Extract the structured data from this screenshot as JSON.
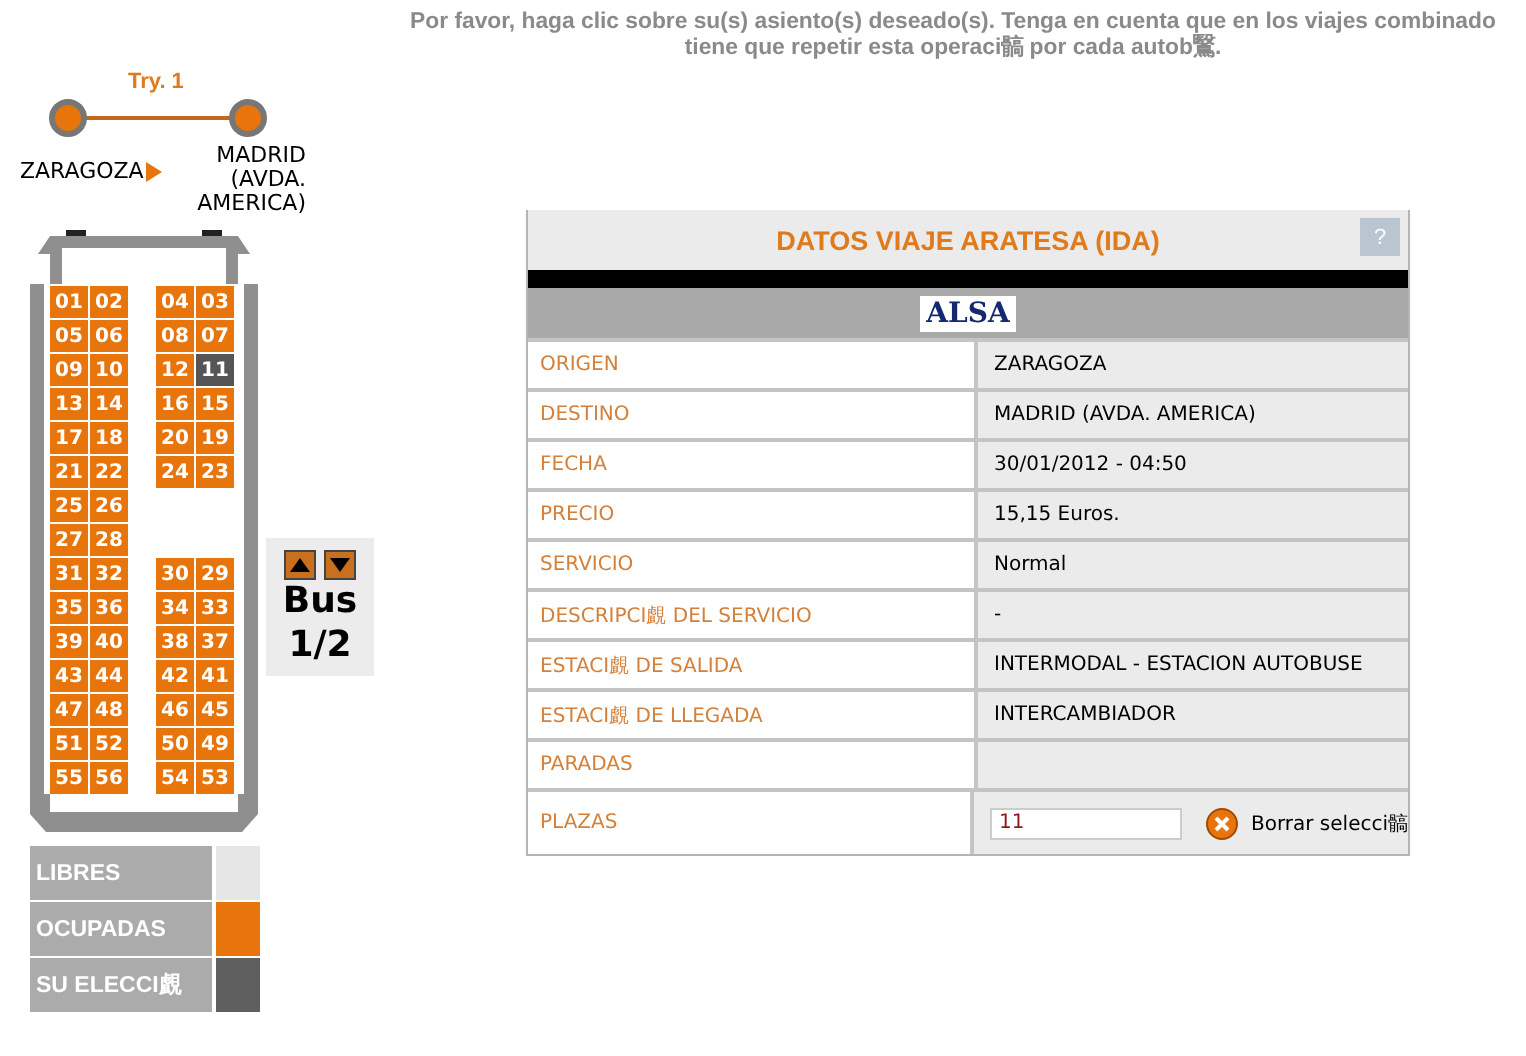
{
  "instructions": [
    "Por favor, haga clic sobre su(s) asiento(s) deseado(s). Tenga en cuenta que en los viajes combinado",
    "tiene que repetir esta operaci髇  por cada autob鷖."
  ],
  "route": {
    "leg": "Try. 1",
    "origin": "ZARAGOZA",
    "destination": "MADRID (AVDA. AMERICA)"
  },
  "seat_rows": [
    {
      "left": [
        {
          "number": "01",
          "selected": false
        },
        {
          "number": "02",
          "selected": false
        }
      ],
      "right": [
        {
          "number": "04",
          "selected": false
        },
        {
          "number": "03",
          "selected": false
        }
      ]
    },
    {
      "left": [
        {
          "number": "05",
          "selected": false
        },
        {
          "number": "06",
          "selected": false
        }
      ],
      "right": [
        {
          "number": "08",
          "selected": false
        },
        {
          "number": "07",
          "selected": false
        }
      ]
    },
    {
      "left": [
        {
          "number": "09",
          "selected": false
        },
        {
          "number": "10",
          "selected": false
        }
      ],
      "right": [
        {
          "number": "12",
          "selected": false
        },
        {
          "number": "11",
          "selected": true
        }
      ]
    },
    {
      "left": [
        {
          "number": "13",
          "selected": false
        },
        {
          "number": "14",
          "selected": false
        }
      ],
      "right": [
        {
          "number": "16",
          "selected": false
        },
        {
          "number": "15",
          "selected": false
        }
      ]
    },
    {
      "left": [
        {
          "number": "17",
          "selected": false
        },
        {
          "number": "18",
          "selected": false
        }
      ],
      "right": [
        {
          "number": "20",
          "selected": false
        },
        {
          "number": "19",
          "selected": false
        }
      ]
    },
    {
      "left": [
        {
          "number": "21",
          "selected": false
        },
        {
          "number": "22",
          "selected": false
        }
      ],
      "right": [
        {
          "number": "24",
          "selected": false
        },
        {
          "number": "23",
          "selected": false
        }
      ]
    },
    {
      "left": [
        {
          "number": "25",
          "selected": false
        },
        {
          "number": "26",
          "selected": false
        }
      ],
      "right": []
    },
    {
      "left": [
        {
          "number": "27",
          "selected": false
        },
        {
          "number": "28",
          "selected": false
        }
      ],
      "right": []
    },
    {
      "left": [
        {
          "number": "31",
          "selected": false
        },
        {
          "number": "32",
          "selected": false
        }
      ],
      "right": [
        {
          "number": "30",
          "selected": false
        },
        {
          "number": "29",
          "selected": false
        }
      ]
    },
    {
      "left": [
        {
          "number": "35",
          "selected": false
        },
        {
          "number": "36",
          "selected": false
        }
      ],
      "right": [
        {
          "number": "34",
          "selected": false
        },
        {
          "number": "33",
          "selected": false
        }
      ]
    },
    {
      "left": [
        {
          "number": "39",
          "selected": false
        },
        {
          "number": "40",
          "selected": false
        }
      ],
      "right": [
        {
          "number": "38",
          "selected": false
        },
        {
          "number": "37",
          "selected": false
        }
      ]
    },
    {
      "left": [
        {
          "number": "43",
          "selected": false
        },
        {
          "number": "44",
          "selected": false
        }
      ],
      "right": [
        {
          "number": "42",
          "selected": false
        },
        {
          "number": "41",
          "selected": false
        }
      ]
    },
    {
      "left": [
        {
          "number": "47",
          "selected": false
        },
        {
          "number": "48",
          "selected": false
        }
      ],
      "right": [
        {
          "number": "46",
          "selected": false
        },
        {
          "number": "45",
          "selected": false
        }
      ]
    },
    {
      "left": [
        {
          "number": "51",
          "selected": false
        },
        {
          "number": "52",
          "selected": false
        }
      ],
      "right": [
        {
          "number": "50",
          "selected": false
        },
        {
          "number": "49",
          "selected": false
        }
      ]
    },
    {
      "left": [
        {
          "number": "55",
          "selected": false
        },
        {
          "number": "56",
          "selected": false
        }
      ],
      "right": [
        {
          "number": "54",
          "selected": false
        },
        {
          "number": "53",
          "selected": false
        }
      ]
    }
  ],
  "bus_nav": {
    "label": "Bus",
    "page": "1/2"
  },
  "legend": [
    {
      "label": "LIBRES",
      "color": "#e6e6e6"
    },
    {
      "label": "OCUPADAS",
      "color": "#e8740c"
    },
    {
      "label": "SU ELECCI覰",
      "color": "#5f5f5f"
    }
  ],
  "panel": {
    "title": "DATOS VIAJE ARATESA (IDA)",
    "help": "?",
    "operator_logo": "ALSA",
    "rows": [
      {
        "label": "ORIGEN",
        "value": "ZARAGOZA",
        "kind": "text"
      },
      {
        "label": "DESTINO",
        "value": "MADRID (AVDA. AMERICA)",
        "kind": "text"
      },
      {
        "label": "FECHA",
        "value": "30/01/2012 - 04:50",
        "kind": "text"
      },
      {
        "label": "PRECIO",
        "value": "15,15 Euros.",
        "kind": "text"
      },
      {
        "label": "SERVICIO",
        "value": "Normal",
        "kind": "text"
      },
      {
        "label": "DESCRIPCI覰  DEL SERVICIO",
        "value": "-",
        "kind": "text"
      },
      {
        "label": "ESTACI覰  DE SALIDA",
        "value": "INTERMODAL - ESTACION AUTOBUSE",
        "kind": "text"
      },
      {
        "label": "ESTACI覰  DE LLEGADA",
        "value": "INTERCAMBIADOR",
        "kind": "text"
      },
      {
        "label": "PARADAS",
        "kind": "text"
      },
      {
        "label": "PLAZAS",
        "value": "11",
        "kind": "seats",
        "clear_label": "Borrar selecci髇"
      }
    ]
  }
}
